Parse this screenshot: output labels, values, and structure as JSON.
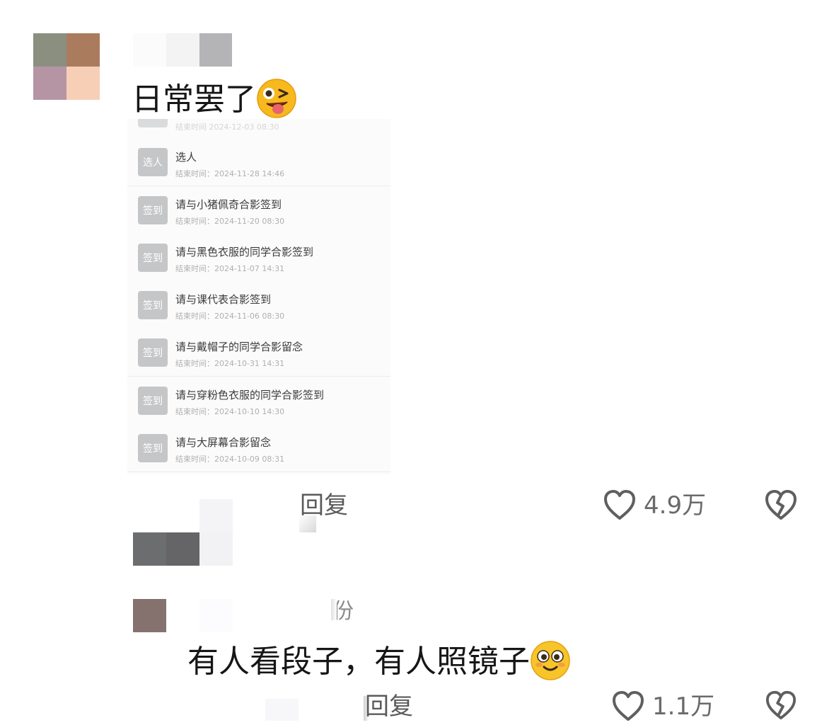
{
  "comments": [
    {
      "text": "日常罢了",
      "emoji": "winking-tongue-emoji",
      "reply_label": "回复",
      "likes": "4.9万"
    },
    {
      "name_fragment": "份",
      "text": "有人看段子，有人照镜子",
      "emoji": "smiling-blush-emoji",
      "reply_label": "回复",
      "likes": "1.1万"
    }
  ],
  "embedded_screenshot": {
    "partial_top_row": {
      "title": "结束时间",
      "time": "2024-12-03 08:30"
    },
    "tasks": [
      {
        "badge": "选人",
        "title": "选人",
        "time_label": "结束时间：",
        "time": "2024-11-28 14:46"
      },
      {
        "badge": "签到",
        "title": "请与小猪佩奇合影签到",
        "time_label": "结束时间：",
        "time": "2024-11-20 08:30"
      },
      {
        "badge": "签到",
        "title": "请与黑色衣服的同学合影签到",
        "time_label": "结束时间：",
        "time": "2024-11-07 14:31"
      },
      {
        "badge": "签到",
        "title": "请与课代表合影签到",
        "time_label": "结束时间：",
        "time": "2024-11-06 08:30"
      },
      {
        "badge": "签到",
        "title": "请与戴帽子的同学合影留念",
        "time_label": "结束时间：",
        "time": "2024-10-31 14:31"
      },
      {
        "badge": "签到",
        "title": "请与穿粉色衣服的同学合影签到",
        "time_label": "结束时间：",
        "time": "2024-10-10 14:30"
      },
      {
        "badge": "签到",
        "title": "请与大屏幕合影留念",
        "time_label": "结束时间：",
        "time": "2024-10-09 08:31"
      }
    ]
  },
  "colors": {
    "heart": "#5f5f5f",
    "badge": "#c5c6c8",
    "avatar_mosaic_1": [
      "#8b8f80",
      "#ab7b5d",
      "#b595a4",
      "#f6cfb6"
    ],
    "avatar_mosaic_2": "#85726f"
  },
  "icons": [
    "heart-outline-icon",
    "broken-heart-icon"
  ]
}
